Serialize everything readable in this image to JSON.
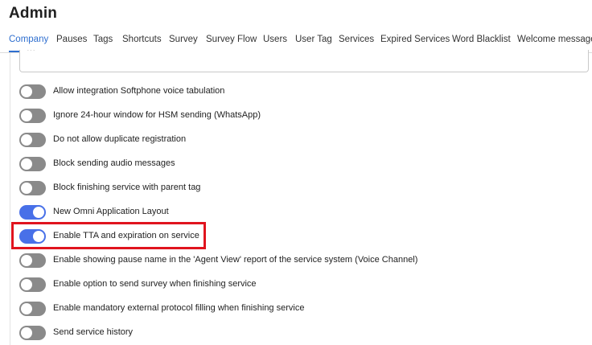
{
  "page": {
    "title": "Admin"
  },
  "tabs": [
    {
      "label": "Company",
      "active": true
    },
    {
      "label": "Pauses",
      "active": false
    },
    {
      "label": "Tags",
      "active": false
    },
    {
      "label": "Shortcuts",
      "active": false
    },
    {
      "label": "Survey",
      "active": false
    },
    {
      "label": "Survey Flow",
      "active": false
    },
    {
      "label": "Users",
      "active": false
    },
    {
      "label": "User Tag",
      "active": false
    },
    {
      "label": "Services",
      "active": false
    },
    {
      "label": "Expired Services",
      "active": false
    },
    {
      "label": "Word Blacklist",
      "active": false
    },
    {
      "label": "Welcome message",
      "active": false
    }
  ],
  "top_input": {
    "value": "···"
  },
  "settings": [
    {
      "label": "Allow integration Softphone voice tabulation",
      "enabled": false
    },
    {
      "label": "Ignore 24-hour window for HSM sending (WhatsApp)",
      "enabled": false
    },
    {
      "label": "Do not allow duplicate registration",
      "enabled": false
    },
    {
      "label": "Block sending audio messages",
      "enabled": false
    },
    {
      "label": "Block finishing service with parent tag",
      "enabled": false
    },
    {
      "label": "New Omni Application Layout",
      "enabled": true
    },
    {
      "label": "Enable TTA and expiration on service",
      "enabled": true
    },
    {
      "label": "Enable showing pause name in the 'Agent View' report of the service system (Voice Channel)",
      "enabled": false
    },
    {
      "label": "Enable option to send survey when finishing service",
      "enabled": false
    },
    {
      "label": "Enable mandatory external protocol filling when finishing service",
      "enabled": false
    },
    {
      "label": "Send service history",
      "enabled": false
    }
  ],
  "colors": {
    "accent": "#2f6fcf",
    "toggle_on": "#4870e8",
    "toggle_off": "#8a8a8a",
    "highlight": "#e0141e"
  }
}
